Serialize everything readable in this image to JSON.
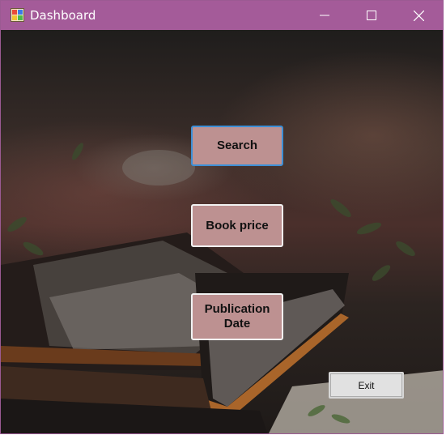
{
  "window": {
    "title": "Dashboard",
    "icon": "winforms-app-icon",
    "controls": [
      "minimize-icon",
      "maximize-icon",
      "close-icon"
    ],
    "accent_color": "#a45b99"
  },
  "buttons": {
    "search": "Search",
    "book_price": "Book  price",
    "publication_date": "Publication\nDate",
    "exit": "Exit"
  },
  "colors": {
    "button_fill": "#bd9191",
    "focused_border": "#3d8fd6",
    "exit_fill": "#e1e1e1"
  }
}
